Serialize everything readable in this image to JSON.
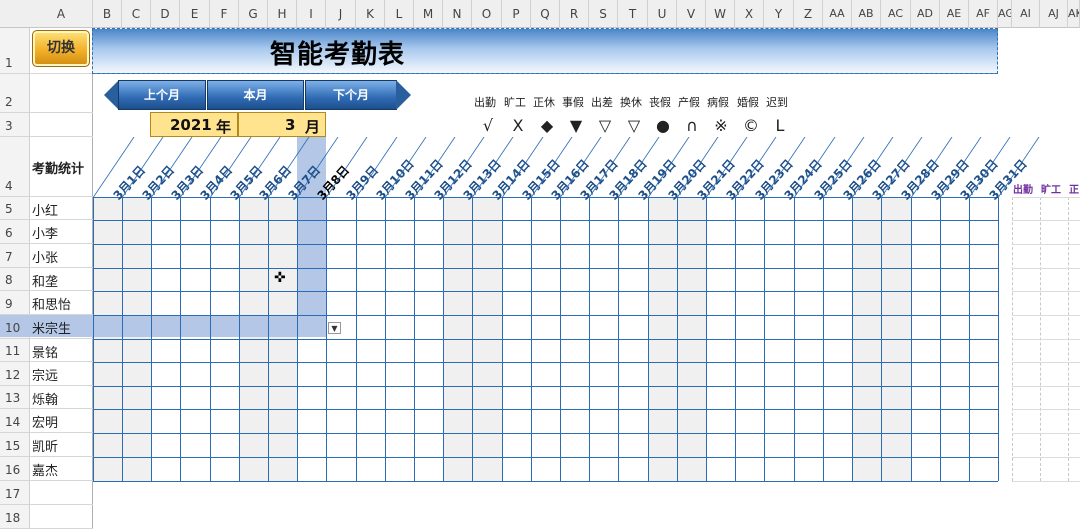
{
  "columns": [
    "A",
    "B",
    "C",
    "D",
    "E",
    "F",
    "G",
    "H",
    "I",
    "J",
    "K",
    "L",
    "M",
    "N",
    "O",
    "P",
    "Q",
    "R",
    "S",
    "T",
    "U",
    "V",
    "W",
    "X",
    "Y",
    "Z",
    "AA",
    "AB",
    "AC",
    "AD",
    "AE",
    "AF",
    "AG",
    "AI",
    "AJ",
    "AK"
  ],
  "header": {
    "title": "智能考勤表",
    "switch_label": "切换",
    "prev_label": "上个月",
    "current_label": "本月",
    "next_label": "下个月",
    "year": "2021",
    "year_unit": "年",
    "month": "3",
    "month_unit": "月"
  },
  "legend": {
    "labels": [
      "出勤",
      "旷工",
      "正休",
      "事假",
      "出差",
      "换休",
      "丧假",
      "产假",
      "病假",
      "婚假",
      "迟到"
    ],
    "symbols": [
      "√",
      "X",
      "◆",
      "▼",
      "▽",
      "▽",
      "●",
      "∩",
      "※",
      "©",
      "L"
    ]
  },
  "stat_label": "考勤统计",
  "dates": [
    "3月1日",
    "3月2日",
    "3月3日",
    "3月4日",
    "3月5日",
    "3月6日",
    "3月7日",
    "3月8日",
    "3月9日",
    "3月10日",
    "3月11日",
    "3月12日",
    "3月13日",
    "3月14日",
    "3月15日",
    "3月16日",
    "3月17日",
    "3月18日",
    "3月19日",
    "3月20日",
    "3月21日",
    "3月22日",
    "3月23日",
    "3月24日",
    "3月25日",
    "3月26日",
    "3月27日",
    "3月28日",
    "3月29日",
    "3月30日",
    "3月31日"
  ],
  "selected_date_index": 7,
  "rows": [
    {
      "num": "1",
      "name": ""
    },
    {
      "num": "2",
      "name": ""
    },
    {
      "num": "3",
      "name": ""
    },
    {
      "num": "4",
      "name": ""
    },
    {
      "num": "5",
      "name": "小红"
    },
    {
      "num": "6",
      "name": "小李"
    },
    {
      "num": "7",
      "name": "小张"
    },
    {
      "num": "8",
      "name": "和垄"
    },
    {
      "num": "9",
      "name": "和思怡"
    },
    {
      "num": "10",
      "name": "米宗生"
    },
    {
      "num": "11",
      "name": "景铭"
    },
    {
      "num": "12",
      "name": "宗远"
    },
    {
      "num": "13",
      "name": "烁翰"
    },
    {
      "num": "14",
      "name": "宏明"
    },
    {
      "num": "15",
      "name": "凯昕"
    },
    {
      "num": "16",
      "name": "嘉杰"
    },
    {
      "num": "17",
      "name": ""
    },
    {
      "num": "18",
      "name": ""
    }
  ],
  "right_labels": [
    "出勤",
    "旷工",
    "正"
  ],
  "colors": {
    "grid_blue": "#2a6db5",
    "highlight": "#b4c7e7",
    "date_text": "#1f4e86",
    "input_bg": "#ffe38f"
  }
}
